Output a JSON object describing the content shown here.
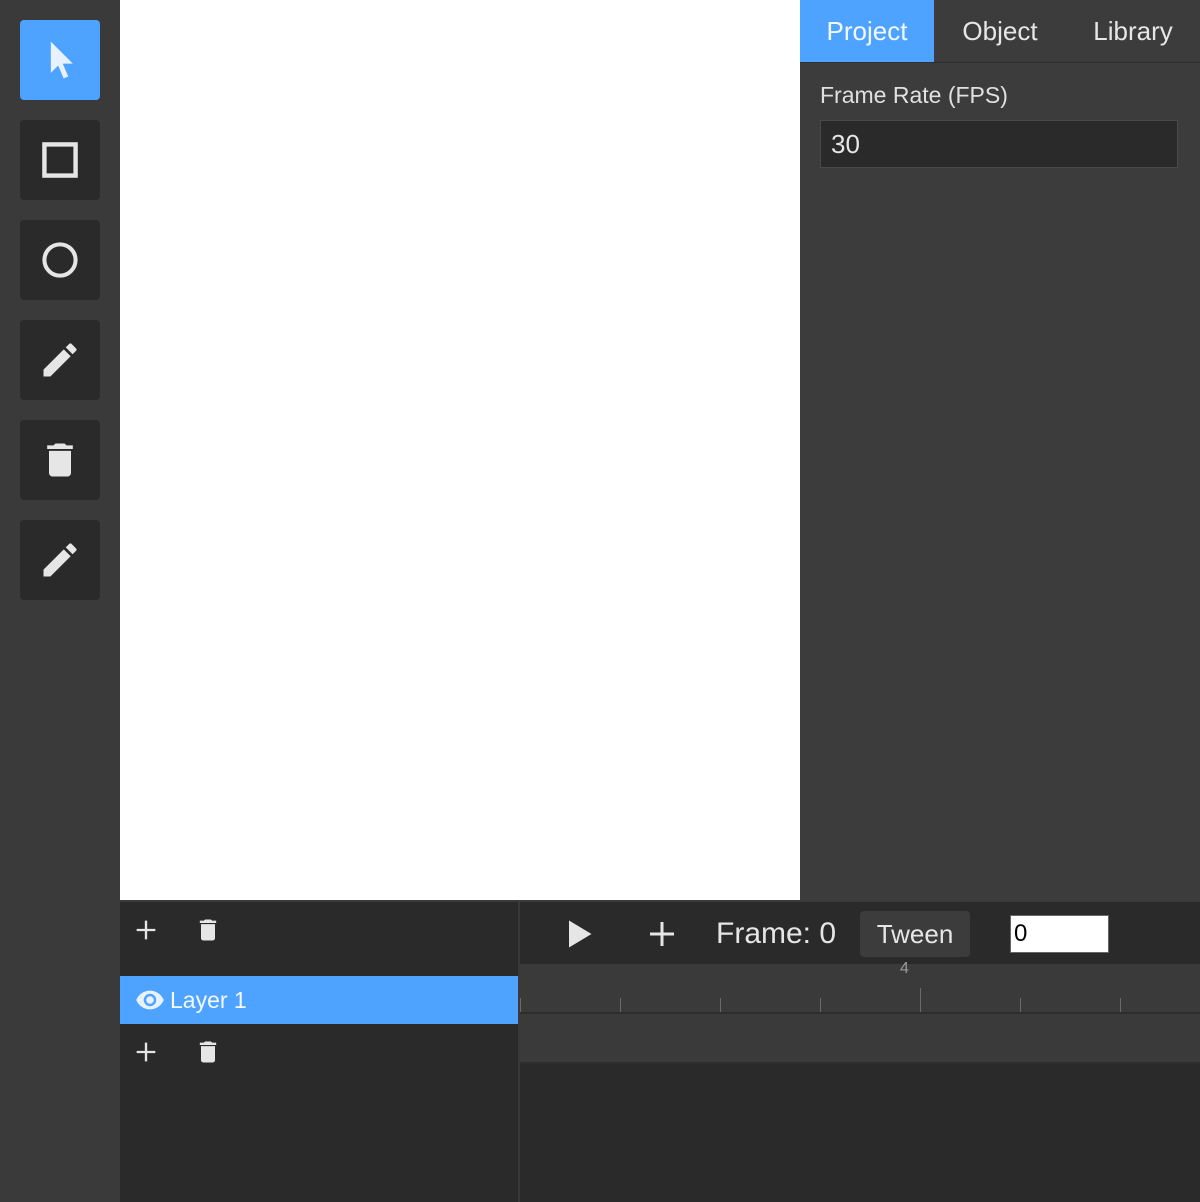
{
  "toolbar": {
    "tools": [
      {
        "name": "select",
        "icon": "cursor-arrow-icon",
        "active": true
      },
      {
        "name": "rectangle",
        "icon": "square-icon",
        "active": false
      },
      {
        "name": "ellipse",
        "icon": "circle-icon",
        "active": false
      },
      {
        "name": "pencil",
        "icon": "pencil-icon",
        "active": false
      },
      {
        "name": "delete",
        "icon": "trash-icon",
        "active": false
      },
      {
        "name": "pen",
        "icon": "pencil-icon",
        "active": false
      }
    ]
  },
  "inspector": {
    "tabs": [
      {
        "label": "Project",
        "active": true
      },
      {
        "label": "Object",
        "active": false
      },
      {
        "label": "Library",
        "active": false
      }
    ],
    "frame_rate": {
      "label": "Frame Rate (FPS)",
      "value": "30"
    }
  },
  "layers": {
    "items": [
      {
        "name": "Layer 1",
        "visible": true,
        "selected": true
      }
    ],
    "add_icon": "plus-icon",
    "delete_icon": "trash-icon",
    "visibility_icon": "eye-icon"
  },
  "timeline": {
    "play_icon": "play-icon",
    "add_icon": "plus-icon",
    "frame_label": "Frame: 0",
    "tween_label": "Tween",
    "tween_value": "0",
    "ruler_label": "4"
  },
  "colors": {
    "accent": "#4da3ff",
    "panel": "#3a3a3a",
    "panel_dark": "#2a2a2a",
    "canvas": "#ffffff"
  }
}
